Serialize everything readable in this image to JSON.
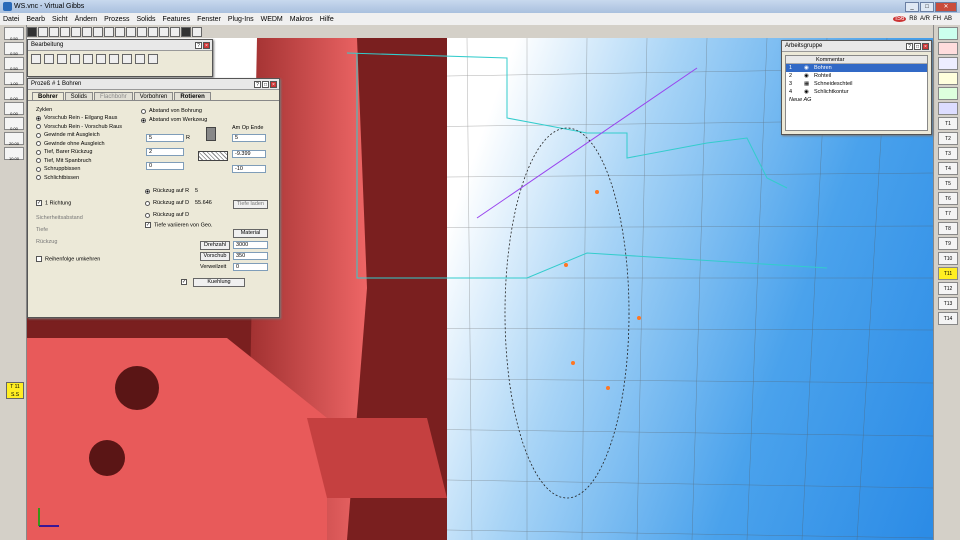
{
  "window": {
    "title": "WS.vnc - Virtual Gibbs",
    "btn_min": "_",
    "btn_max": "□",
    "btn_close": "✕"
  },
  "menu": [
    "Datei",
    "Bearb",
    "Sicht",
    "Ändern",
    "Prozess",
    "Solids",
    "Features",
    "Fenster",
    "Plug-Ins",
    "WEDM",
    "Makros",
    "Hilfe"
  ],
  "menu_right": {
    "r1": "R8",
    "r2": "A/R",
    "r3": "FH",
    "r4": "AB",
    "badge": "IS6"
  },
  "left_values": [
    "0.50",
    "0.50",
    "0.50",
    "1.00",
    "0.00",
    "0.00",
    "0.00",
    "20.00",
    "10.00"
  ],
  "right_tools": [
    "T1",
    "T2",
    "T3",
    "T4",
    "T5",
    "T6",
    "T7",
    "T8",
    "T9",
    "T10",
    "T11",
    "T12",
    "T13",
    "T14"
  ],
  "tool_info": {
    "tool": "T 11",
    "value": "S.S"
  },
  "bearbeitung": {
    "title": "Bearbeitung"
  },
  "prozess": {
    "title": "Prozeß # 1 Bohren",
    "tabs": [
      "Bohrer",
      "Solids",
      "Flachbohr",
      "Vorbohren",
      "Rotieren"
    ],
    "zyklen_label": "Zyklen",
    "zyklen": [
      "Vorschub Rein - Eilgang Raus",
      "Vorschub Rein - Vorschub Raus",
      "Gewinde mit Ausgleich",
      "Gewinde ohne Ausgleich",
      "Tief, Barer Rückzug",
      "Tief, Mit Spanbruch",
      "Schruppbissen",
      "Schlichtbissen"
    ],
    "opt1": "Abstand von Bohrung",
    "opt2": "Abstand vom Werkzeug",
    "am_op_ende": "Am Op Ende",
    "f1": "5",
    "f1lbl": "R",
    "f2": "2",
    "f3": "0",
    "r1": "5",
    "r2": "-9.399",
    "r3": "-10",
    "eine_richtung": "1 Richtung",
    "sicherheit": "Sicherheitsabstand",
    "tiefe": "Tiefe",
    "rueckzug": "Rückzug",
    "rueckzug_r": "Rückzug auf R",
    "rueckzug_r_val": "5",
    "rueckzug_d": "Rückzug auf D",
    "rueckzug_d_val": "55.646",
    "rueckzug_d2": "Rückzug auf D",
    "tiefe_laden": "Tiefe laden",
    "tiefe_variieren": "Tiefe variieren von Geo.",
    "material": "Material",
    "reihenfolge": "Reihenfolge umkehren",
    "drehzahl": "Drehzahl",
    "drehzahl_val": "3000",
    "vorschub": "Vorschub",
    "vorschub_val": "350",
    "verweilzeit": "Verweilzeit",
    "verweilzeit_val": "0",
    "kuehlung": "Kuehlung"
  },
  "arbeitsgruppe": {
    "title": "Arbeitsgruppe",
    "col": "Kommentar",
    "rows": [
      {
        "n": "1",
        "name": "Bohren"
      },
      {
        "n": "2",
        "name": "Rohteil"
      },
      {
        "n": "3",
        "name": "Schneideschteil"
      },
      {
        "n": "4",
        "name": "Schlichtkontur"
      }
    ],
    "new_group": "Neue AG"
  },
  "colors": {
    "accent": "#3169c6",
    "part": "#e65a5a",
    "toolpath": "#33cccc",
    "sky": "#2b8be6"
  }
}
